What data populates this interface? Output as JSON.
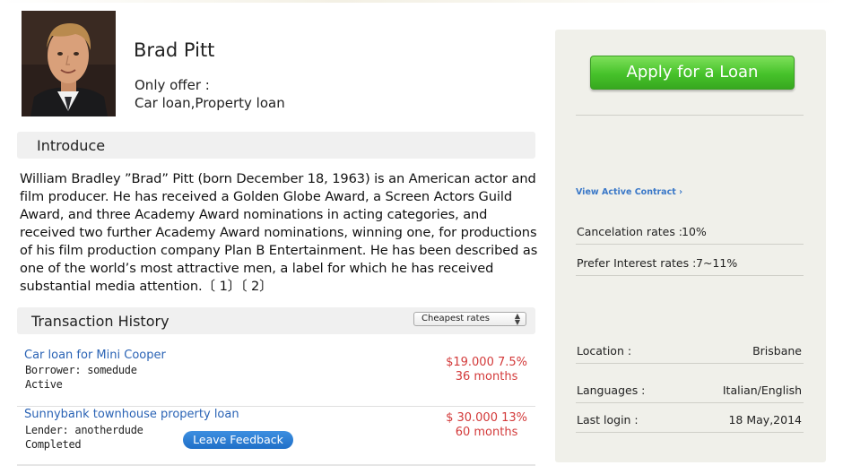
{
  "profile": {
    "name": "Brad Pitt",
    "offer_label": "Only offer :",
    "offer_types": "Car loan,Property loan"
  },
  "introduce": {
    "title": "Introduce",
    "bio": "William Bradley ”Brad” Pitt (born December 18, 1963) is an American actor and film producer. He has received a Golden Globe Award, a Screen Actors Guild Award, and three Academy Award nominations in acting categories, and received two further Academy Award nominations, winning one, for productions of his film production company Plan B Entertainment. He has been described as one of the world’s most attractive men, a label for which he has received substantial media attention.〔 1〕〔 2〕"
  },
  "history": {
    "title": "Transaction History",
    "sort_value": "Cheapest rates",
    "transactions": [
      {
        "title": "Car loan for Mini Cooper",
        "party": "Borrower: somedude",
        "status": "Active",
        "rate": "$19.000 7.5%",
        "term": "36 months"
      },
      {
        "title": "Sunnybank townhouse property loan",
        "party": "Lender: anotherdude",
        "status": "Completed",
        "rate": "$ 30.000 13%",
        "term": "60 months",
        "feedback_label": "Leave Feedback"
      }
    ]
  },
  "sidebar": {
    "apply_label": "Apply for a Loan",
    "active_contract_link": "View Active Contract ›",
    "cancelation": {
      "label": "Cancelation rates :",
      "value": "10%"
    },
    "prefer_interest": {
      "label": "Prefer Interest rates :",
      "value": "7~11%"
    },
    "location": {
      "label": "Location :",
      "value": "Brisbane"
    },
    "languages": {
      "label": "Languages :",
      "value": "Italian/English"
    },
    "last_login": {
      "label": "Last login :",
      "value": "18 May,2014"
    }
  },
  "colors": {
    "link_blue": "#2a63b5",
    "rate_red": "#d33a3a",
    "apply_green": "#46c22a",
    "feedback_blue": "#1f6fc8",
    "panel_bg": "#f0f0ea"
  }
}
